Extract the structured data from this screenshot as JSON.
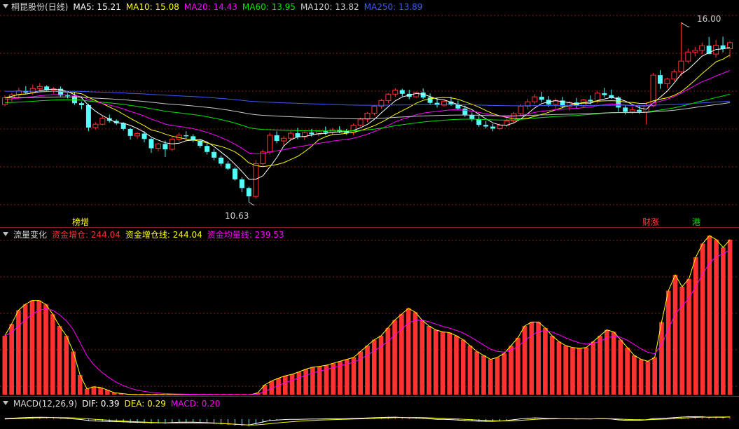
{
  "colors": {
    "up": "#ff3232",
    "down": "#54fcfc",
    "ma5": "#ffffff",
    "ma10": "#ffff00",
    "ma20": "#ff00ff",
    "ma60": "#00e600",
    "ma120": "#c8c8c8",
    "ma250": "#3c5aff",
    "grid": "#8b1a1a"
  },
  "panel1": {
    "title": "桐昆股份(日线)",
    "ma_labels": [
      "MA5: 15.21",
      "MA10: 15.08",
      "MA20: 14.43",
      "MA60: 13.95",
      "MA120: 13.82",
      "MA250: 13.89"
    ],
    "high_label": "16.00",
    "low_label": "10.63",
    "tags": [
      "榜增",
      "财涨",
      "港"
    ]
  },
  "panel2": {
    "title": "流量变化",
    "labels": [
      "资金增仓: 244.04",
      "资金增仓线: 244.04",
      "资金均量线: 239.53"
    ]
  },
  "panel3": {
    "title": "MACD(12,26,9)",
    "labels": [
      "DIF: 0.39",
      "DEA: 0.29",
      "MACD: 0.20"
    ]
  },
  "chart_data": [
    {
      "type": "candlestick",
      "title": "桐昆股份(日线)",
      "ylim": [
        10.3,
        16.3
      ],
      "series_names": [
        "MA5",
        "MA10",
        "MA20",
        "MA60",
        "MA120",
        "MA250"
      ],
      "ohlc": [
        [
          13.55,
          13.82,
          13.5,
          13.75
        ],
        [
          13.75,
          13.9,
          13.64,
          13.84
        ],
        [
          13.84,
          14.05,
          13.76,
          13.96
        ],
        [
          13.96,
          14.1,
          13.86,
          13.91
        ],
        [
          13.91,
          14.15,
          13.84,
          14.03
        ],
        [
          14.03,
          14.19,
          13.96,
          14.09
        ],
        [
          14.09,
          14.13,
          13.93,
          13.98
        ],
        [
          13.98,
          14.07,
          13.88,
          14.02
        ],
        [
          14.02,
          14.09,
          13.79,
          13.82
        ],
        [
          13.82,
          13.88,
          13.73,
          13.8
        ],
        [
          13.8,
          13.93,
          13.54,
          13.59
        ],
        [
          13.59,
          13.64,
          13.41,
          13.53
        ],
        [
          13.53,
          13.57,
          12.75,
          12.86
        ],
        [
          12.86,
          13.02,
          12.8,
          12.96
        ],
        [
          12.96,
          13.2,
          12.93,
          13.14
        ],
        [
          13.14,
          13.25,
          13.01,
          13.06
        ],
        [
          13.06,
          13.1,
          12.94,
          12.99
        ],
        [
          12.99,
          13.02,
          12.77,
          12.82
        ],
        [
          12.82,
          12.85,
          12.5,
          12.61
        ],
        [
          12.61,
          12.72,
          12.52,
          12.68
        ],
        [
          12.68,
          12.75,
          12.42,
          12.52
        ],
        [
          12.52,
          12.55,
          12.1,
          12.24
        ],
        [
          12.24,
          12.4,
          12.14,
          12.37
        ],
        [
          12.37,
          12.47,
          11.98,
          12.21
        ],
        [
          12.21,
          12.57,
          12.15,
          12.51
        ],
        [
          12.51,
          12.71,
          12.44,
          12.63
        ],
        [
          12.63,
          12.75,
          12.52,
          12.6
        ],
        [
          12.6,
          12.66,
          12.42,
          12.47
        ],
        [
          12.47,
          12.5,
          12.25,
          12.31
        ],
        [
          12.31,
          12.38,
          12.05,
          12.13
        ],
        [
          12.13,
          12.22,
          11.88,
          11.96
        ],
        [
          11.96,
          12.02,
          11.71,
          11.78
        ],
        [
          11.78,
          11.85,
          11.59,
          11.63
        ],
        [
          11.63,
          11.67,
          11.27,
          11.31
        ],
        [
          11.31,
          11.37,
          10.93,
          11.05
        ],
        [
          11.05,
          11.09,
          10.63,
          10.8
        ],
        [
          10.8,
          11.89,
          10.74,
          11.78
        ],
        [
          11.78,
          12.2,
          11.71,
          12.13
        ],
        [
          12.13,
          12.71,
          12.05,
          12.63
        ],
        [
          12.63,
          12.75,
          12.39,
          12.46
        ],
        [
          12.46,
          12.61,
          12.3,
          12.54
        ],
        [
          12.54,
          12.76,
          12.48,
          12.69
        ],
        [
          12.69,
          12.85,
          12.51,
          12.58
        ],
        [
          12.58,
          12.75,
          12.49,
          12.71
        ],
        [
          12.71,
          12.82,
          12.59,
          12.66
        ],
        [
          12.66,
          12.78,
          12.6,
          12.75
        ],
        [
          12.75,
          12.89,
          12.64,
          12.71
        ],
        [
          12.71,
          12.85,
          12.66,
          12.79
        ],
        [
          12.79,
          12.9,
          12.69,
          12.74
        ],
        [
          12.74,
          12.82,
          12.64,
          12.7
        ],
        [
          12.7,
          12.98,
          12.63,
          12.93
        ],
        [
          12.93,
          13.16,
          12.89,
          13.11
        ],
        [
          13.11,
          13.33,
          13.02,
          13.29
        ],
        [
          13.29,
          13.54,
          13.23,
          13.5
        ],
        [
          13.5,
          13.72,
          13.43,
          13.67
        ],
        [
          13.67,
          13.89,
          13.6,
          13.86
        ],
        [
          13.86,
          14.04,
          13.78,
          13.98
        ],
        [
          13.98,
          14.02,
          13.79,
          13.87
        ],
        [
          13.87,
          13.99,
          13.71,
          13.78
        ],
        [
          13.78,
          13.94,
          13.75,
          13.91
        ],
        [
          13.91,
          14.03,
          13.72,
          13.76
        ],
        [
          13.76,
          13.88,
          13.55,
          13.6
        ],
        [
          13.6,
          13.75,
          13.46,
          13.53
        ],
        [
          13.53,
          13.69,
          13.48,
          13.64
        ],
        [
          13.64,
          13.78,
          13.51,
          13.56
        ],
        [
          13.56,
          13.67,
          13.38,
          13.43
        ],
        [
          13.43,
          13.52,
          13.18,
          13.24
        ],
        [
          13.24,
          13.31,
          13.04,
          13.11
        ],
        [
          13.11,
          13.2,
          12.88,
          12.94
        ],
        [
          12.94,
          13.05,
          12.83,
          12.89
        ],
        [
          12.89,
          12.97,
          12.75,
          12.83
        ],
        [
          12.83,
          12.98,
          12.79,
          12.93
        ],
        [
          12.93,
          13.13,
          12.88,
          13.06
        ],
        [
          13.06,
          13.33,
          13.0,
          13.28
        ],
        [
          13.28,
          13.56,
          13.21,
          13.5
        ],
        [
          13.5,
          13.72,
          13.41,
          13.63
        ],
        [
          13.63,
          13.86,
          13.57,
          13.78
        ],
        [
          13.78,
          13.93,
          13.61,
          13.69
        ],
        [
          13.69,
          13.8,
          13.48,
          13.55
        ],
        [
          13.55,
          13.73,
          13.42,
          13.67
        ],
        [
          13.67,
          13.78,
          13.44,
          13.49
        ],
        [
          13.49,
          13.65,
          13.37,
          13.61
        ],
        [
          13.61,
          13.75,
          13.43,
          13.51
        ],
        [
          13.51,
          13.72,
          13.45,
          13.69
        ],
        [
          13.69,
          13.82,
          13.56,
          13.65
        ],
        [
          13.65,
          13.96,
          13.58,
          13.89
        ],
        [
          13.89,
          14.05,
          13.76,
          13.83
        ],
        [
          13.83,
          14.0,
          13.72,
          13.76
        ],
        [
          13.76,
          13.8,
          13.33,
          13.46
        ],
        [
          13.46,
          13.53,
          13.25,
          13.33
        ],
        [
          13.33,
          13.48,
          13.27,
          13.39
        ],
        [
          13.39,
          13.52,
          13.27,
          13.33
        ],
        [
          13.33,
          13.62,
          12.95,
          13.51
        ],
        [
          13.51,
          14.5,
          13.47,
          14.43
        ],
        [
          14.43,
          14.58,
          14.02,
          14.17
        ],
        [
          14.17,
          14.35,
          14.04,
          14.31
        ],
        [
          14.31,
          14.6,
          14.24,
          14.53
        ],
        [
          14.53,
          16.0,
          14.41,
          14.85
        ],
        [
          14.85,
          15.22,
          14.79,
          15.12
        ],
        [
          15.12,
          15.27,
          14.99,
          15.17
        ],
        [
          15.17,
          15.4,
          15.06,
          15.31
        ],
        [
          15.31,
          15.57,
          15.17,
          15.06
        ],
        [
          15.06,
          15.48,
          14.95,
          15.32
        ],
        [
          15.32,
          15.58,
          15.11,
          15.22
        ],
        [
          15.22,
          15.45,
          14.95,
          15.4
        ]
      ]
    },
    {
      "type": "bar",
      "title": "流量变化",
      "series_names": [
        "资金增仓",
        "资金增仓线",
        "资金均量线"
      ],
      "ylim": [
        0,
        400
      ],
      "values": [
        150,
        180,
        215,
        230,
        240,
        240,
        230,
        205,
        175,
        150,
        110,
        50,
        15,
        20,
        18,
        12,
        5,
        3,
        1,
        0,
        0,
        0,
        0,
        0,
        0,
        0,
        0,
        0,
        0,
        0,
        0,
        0,
        0,
        0,
        0,
        0,
        0,
        5,
        25,
        35,
        42,
        48,
        52,
        58,
        65,
        70,
        72,
        75,
        80,
        85,
        90,
        95,
        110,
        125,
        140,
        150,
        170,
        190,
        205,
        220,
        210,
        190,
        175,
        165,
        160,
        158,
        150,
        140,
        125,
        110,
        100,
        90,
        95,
        105,
        125,
        145,
        175,
        185,
        185,
        170,
        150,
        135,
        125,
        120,
        118,
        120,
        135,
        150,
        165,
        160,
        140,
        120,
        100,
        90,
        85,
        95,
        185,
        265,
        305,
        275,
        295,
        350,
        385,
        405,
        395,
        375,
        395
      ],
      "line_values": [
        150,
        180,
        215,
        230,
        240,
        240,
        230,
        205,
        175,
        150,
        110,
        50,
        15,
        20,
        18,
        12,
        5,
        3,
        1,
        0,
        0,
        0,
        0,
        0,
        0,
        0,
        0,
        0,
        0,
        0,
        0,
        0,
        0,
        0,
        0,
        0,
        0,
        5,
        25,
        35,
        42,
        48,
        52,
        58,
        65,
        70,
        72,
        75,
        80,
        85,
        90,
        95,
        110,
        125,
        140,
        150,
        170,
        190,
        205,
        220,
        210,
        190,
        175,
        165,
        160,
        158,
        150,
        140,
        125,
        110,
        100,
        90,
        95,
        105,
        125,
        145,
        175,
        185,
        185,
        170,
        150,
        135,
        125,
        120,
        118,
        120,
        135,
        150,
        165,
        160,
        140,
        120,
        100,
        90,
        85,
        95,
        185,
        265,
        305,
        275,
        295,
        350,
        385,
        405,
        395,
        375,
        395
      ]
    },
    {
      "type": "bar",
      "title": "MACD(12,26,9)",
      "series_names": [
        "DIF",
        "DEA",
        "MACD"
      ],
      "ylim": [
        -0.6,
        0.6
      ],
      "values": [
        0.06,
        0.09,
        0.12,
        0.14,
        0.16,
        0.17,
        0.16,
        0.14,
        0.1,
        0.06,
        0.02,
        -0.04,
        -0.12,
        -0.16,
        -0.18,
        -0.2,
        -0.22,
        -0.24,
        -0.27,
        -0.28,
        -0.3,
        -0.32,
        -0.31,
        -0.33,
        -0.3,
        -0.27,
        -0.26,
        -0.27,
        -0.29,
        -0.31,
        -0.34,
        -0.38,
        -0.41,
        -0.45,
        -0.49,
        -0.52,
        -0.38,
        -0.25,
        -0.12,
        -0.08,
        -0.04,
        -0.01,
        -0.02,
        0.0,
        0.01,
        0.02,
        0.03,
        0.04,
        0.04,
        0.05,
        0.07,
        0.09,
        0.11,
        0.13,
        0.15,
        0.17,
        0.18,
        0.15,
        0.12,
        0.11,
        0.08,
        0.03,
        -0.01,
        -0.02,
        -0.04,
        -0.08,
        -0.12,
        -0.15,
        -0.18,
        -0.19,
        -0.19,
        -0.16,
        -0.12,
        -0.05,
        0.03,
        0.08,
        0.12,
        0.1,
        0.06,
        0.06,
        0.03,
        0.04,
        0.02,
        0.03,
        0.02,
        0.05,
        0.04,
        0.02,
        -0.06,
        -0.1,
        -0.1,
        -0.1,
        -0.06,
        0.06,
        0.08,
        0.1,
        0.14,
        0.18,
        0.22,
        0.22,
        0.22,
        0.16,
        0.18,
        0.16,
        0.2
      ]
    }
  ]
}
